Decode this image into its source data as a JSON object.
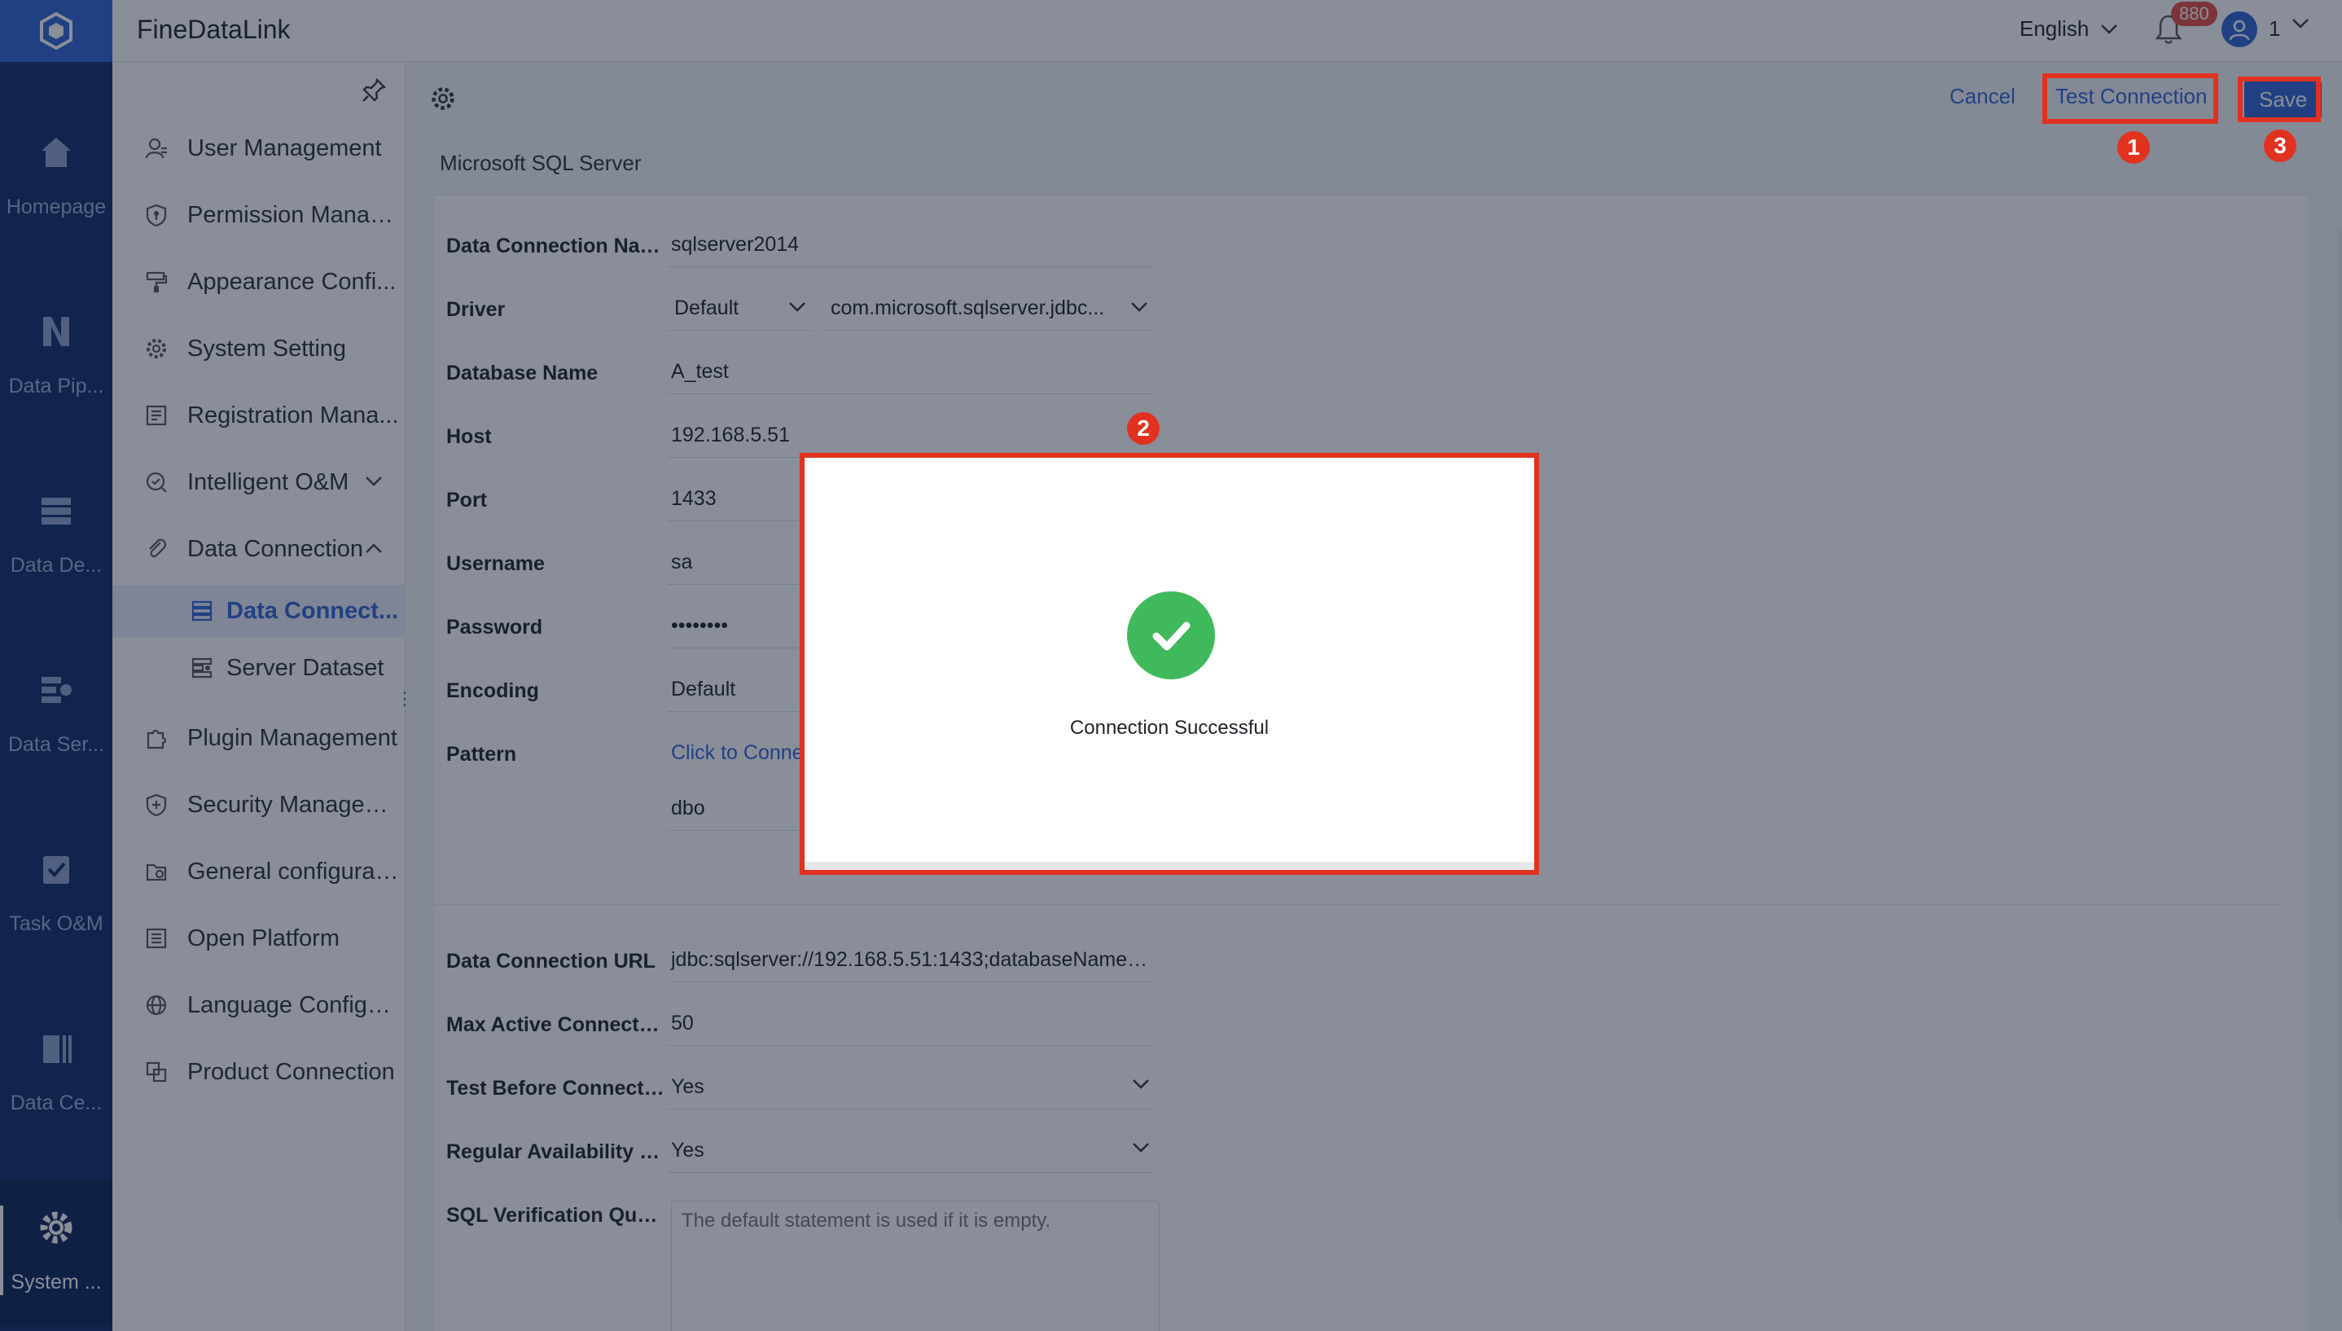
{
  "app": {
    "title": "FineDataLink"
  },
  "header": {
    "language": "English",
    "notification_count": "880",
    "user_label": "1"
  },
  "rail": {
    "items": [
      {
        "label": "Homepage",
        "icon": "home-icon"
      },
      {
        "label": "Data Pip...",
        "icon": "pipeline-icon"
      },
      {
        "label": "Data De...",
        "icon": "data-development-icon"
      },
      {
        "label": "Data Ser...",
        "icon": "data-service-icon"
      },
      {
        "label": "Task O&M",
        "icon": "task-om-icon"
      },
      {
        "label": "Data Ce...",
        "icon": "data-center-icon"
      },
      {
        "label": "System ...",
        "icon": "gear-icon"
      }
    ]
  },
  "sidebar": {
    "items": [
      {
        "label": "User Management",
        "icon": "user-icon"
      },
      {
        "label": "Permission Manag...",
        "icon": "shield-icon"
      },
      {
        "label": "Appearance Confi...",
        "icon": "paint-roller-icon"
      },
      {
        "label": "System Setting",
        "icon": "gear-icon"
      },
      {
        "label": "Registration Mana...",
        "icon": "registration-icon"
      },
      {
        "label": "Intelligent O&M",
        "icon": "om-icon"
      },
      {
        "label": "Data Connection",
        "icon": "paperclip-icon"
      },
      {
        "label": "Data Connect...",
        "icon": "database-icon"
      },
      {
        "label": "Server Dataset",
        "icon": "dataset-icon"
      },
      {
        "label": "Plugin Management",
        "icon": "puzzle-icon"
      },
      {
        "label": "Security Managem...",
        "icon": "security-icon"
      },
      {
        "label": "General configurati...",
        "icon": "folder-gear-icon"
      },
      {
        "label": "Open Platform",
        "icon": "list-icon"
      },
      {
        "label": "Language Configu...",
        "icon": "globe-icon"
      },
      {
        "label": "Product Connection",
        "icon": "link-squares-icon"
      }
    ]
  },
  "toolbar": {
    "cancel_label": "Cancel",
    "test_label": "Test Connection",
    "save_label": "Save"
  },
  "form": {
    "db_type": "Microsoft SQL Server",
    "name_label": "Data Connection Name",
    "name_value": "sqlserver2014",
    "driver_label": "Driver",
    "driver_mode": "Default",
    "driver_class": "com.microsoft.sqlserver.jdbc...",
    "dbname_label": "Database Name",
    "dbname_value": "A_test",
    "host_label": "Host",
    "host_value": "192.168.5.51",
    "port_label": "Port",
    "port_value": "1433",
    "username_label": "Username",
    "username_value": "sa",
    "password_label": "Password",
    "password_value": "••••••••",
    "encoding_label": "Encoding",
    "encoding_value": "Default",
    "pattern_label": "Pattern",
    "pattern_link": "Click to Conne",
    "pattern_value": "dbo",
    "url_label": "Data Connection URL",
    "url_value": "jdbc:sqlserver://192.168.5.51:1433;databaseName=...",
    "maxconn_label": "Max Active Connection",
    "maxconn_value": "50",
    "testbefore_label": "Test Before Connection",
    "testbefore_value": "Yes",
    "regular_label": "Regular Availability C...",
    "regular_value": "Yes",
    "sql_label": "SQL Verification Query",
    "sql_placeholder": "The default statement is used if it is empty."
  },
  "modal": {
    "message": "Connection Successful"
  },
  "annotations": [
    "1",
    "2",
    "3"
  ],
  "colors": {
    "accent": "#2f63d6",
    "rail": "#0d2a6b",
    "success": "#3fb95b",
    "annotation": "#e0321f"
  }
}
